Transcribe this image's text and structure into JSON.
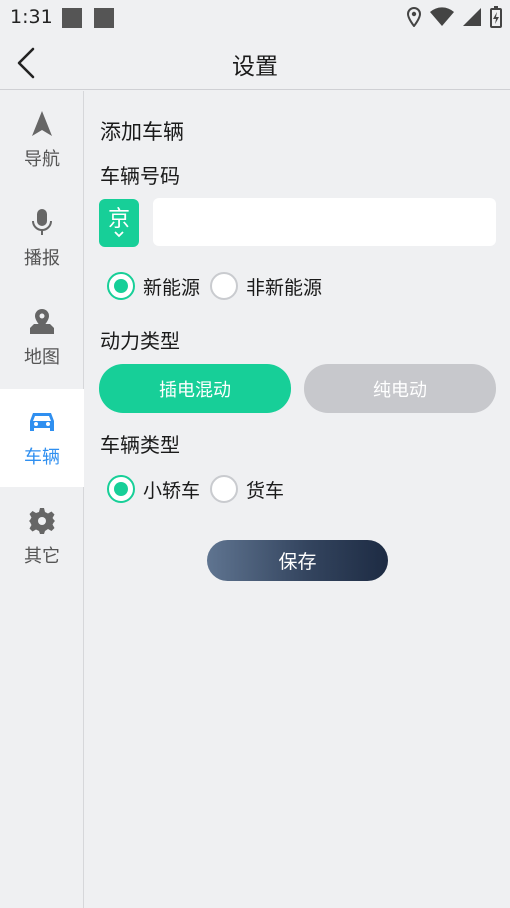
{
  "status_bar": {
    "time": "1:31",
    "icons": [
      "location-icon",
      "wifi-icon",
      "signal-icon",
      "battery-charging-icon"
    ]
  },
  "header": {
    "title": "设置",
    "back_icon": "chevron-left-icon"
  },
  "sidebar": {
    "items": [
      {
        "label": "导航",
        "icon": "navigation-arrow-icon",
        "active": false
      },
      {
        "label": "播报",
        "icon": "microphone-icon",
        "active": false
      },
      {
        "label": "地图",
        "icon": "map-pin-icon",
        "active": false
      },
      {
        "label": "车辆",
        "icon": "car-icon",
        "active": true
      },
      {
        "label": "其它",
        "icon": "gear-icon",
        "active": false
      }
    ]
  },
  "main": {
    "title": "添加车辆",
    "plate": {
      "label": "车辆号码",
      "province": "京",
      "number_value": "",
      "number_placeholder": ""
    },
    "energy": {
      "options": [
        {
          "label": "新能源",
          "selected": true
        },
        {
          "label": "非新能源",
          "selected": false
        }
      ]
    },
    "power": {
      "label": "动力类型",
      "options": [
        {
          "label": "插电混动",
          "selected": true
        },
        {
          "label": "纯电动",
          "selected": false
        }
      ]
    },
    "vehicle_type": {
      "label": "车辆类型",
      "options": [
        {
          "label": "小轿车",
          "selected": true
        },
        {
          "label": "货车",
          "selected": false
        }
      ]
    },
    "save_label": "保存"
  },
  "colors": {
    "accent": "#17cf98",
    "active_nav": "#2f8ff0",
    "inactive_button": "#c7c8cc",
    "background": "#eff0f2"
  }
}
